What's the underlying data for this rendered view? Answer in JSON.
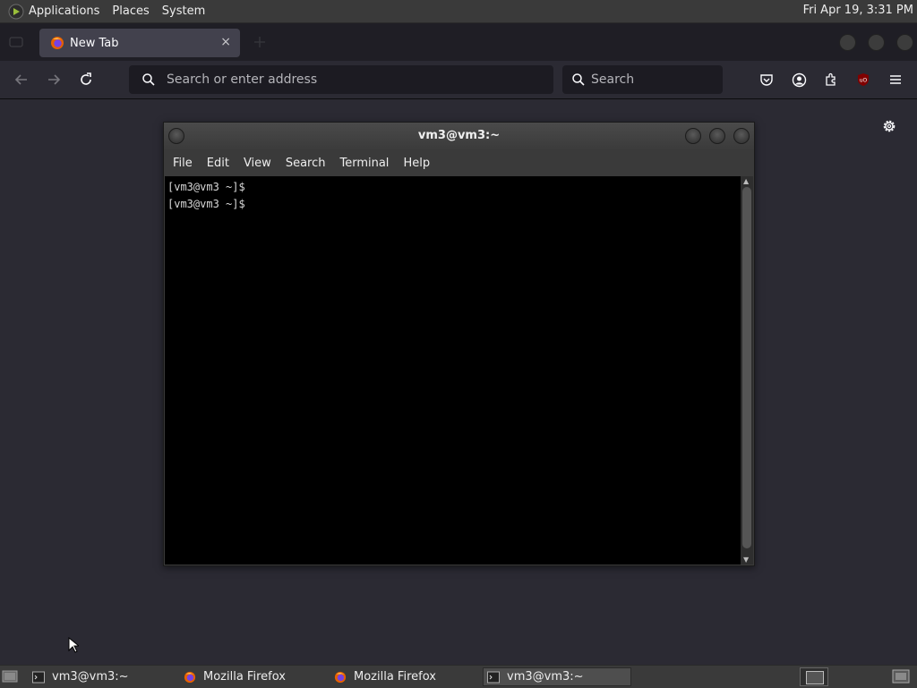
{
  "top_panel": {
    "menus": [
      "Applications",
      "Places",
      "System"
    ],
    "clock": "Fri Apr 19,  3:31 PM"
  },
  "firefox": {
    "tab": {
      "title": "New Tab",
      "close": "×"
    },
    "url_bar": {
      "placeholder": "Search or enter address"
    },
    "search_bar": {
      "placeholder": "Search"
    }
  },
  "terminal": {
    "title": "vm3@vm3:~",
    "menu": [
      "File",
      "Edit",
      "View",
      "Search",
      "Terminal",
      "Help"
    ],
    "lines": [
      "[vm3@vm3 ~]$",
      "[vm3@vm3 ~]$"
    ]
  },
  "taskbar": {
    "tasks": [
      {
        "label": "vm3@vm3:~",
        "icon": "terminal-icon"
      },
      {
        "label": "Mozilla Firefox",
        "icon": "firefox-icon"
      },
      {
        "label": "Mozilla Firefox",
        "icon": "firefox-icon"
      },
      {
        "label": "vm3@vm3:~",
        "icon": "terminal-icon",
        "active": true
      }
    ]
  },
  "colors": {
    "panel": "#3a3a3a",
    "firefox_bg": "#2b2a33",
    "terminal_bg": "#000000",
    "ublock_red": "#c1272d"
  }
}
